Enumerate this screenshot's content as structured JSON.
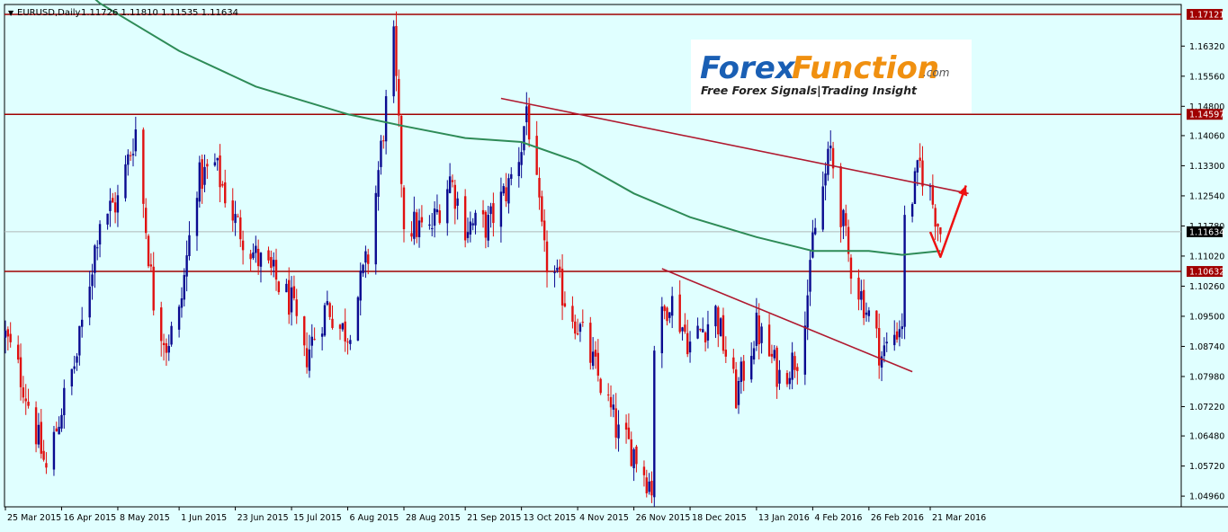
{
  "header": {
    "symbol": "EURUSD,Daily",
    "ohlc": "1.11726 1.11810 1.11535 1.11634",
    "dropdown_glyph": "▼"
  },
  "logo": {
    "brand_part1": "Forex",
    "brand_part2": "Function",
    "suffix": ".com",
    "tagline": "Free Forex Signals|Trading Insight"
  },
  "colors": {
    "background": "#e0ffff",
    "bull": "#0a0a90",
    "bear": "#e01010",
    "ma": "#2e8b57",
    "level": "#a00000",
    "trend": "#b01a30",
    "arrow": "#ee1111"
  },
  "chart_data": {
    "type": "candlestick",
    "symbol": "EURUSD",
    "timeframe": "Daily",
    "y_ticks": [
      "1.16320",
      "1.15560",
      "1.14800",
      "1.14060",
      "1.13300",
      "1.12540",
      "1.11780",
      "1.11020",
      "1.10260",
      "1.09500",
      "1.08740",
      "1.07980",
      "1.07220",
      "1.06480",
      "1.05720",
      "1.04960"
    ],
    "ylim": [
      1.0469,
      1.1737
    ],
    "x_ticks": [
      "25 Mar 2015",
      "16 Apr 2015",
      "8 May 2015",
      "1 Jun 2015",
      "23 Jun 2015",
      "15 Jul 2015",
      "6 Aug 2015",
      "28 Aug 2015",
      "21 Sep 2015",
      "13 Oct 2015",
      "4 Nov 2015",
      "26 Nov 2015",
      "18 Dec 2015",
      "13 Jan 2016",
      "4 Feb 2016",
      "26 Feb 2016",
      "21 Mar 2016"
    ],
    "horizontal_levels": [
      {
        "label": "1.17121",
        "value": 1.17121
      },
      {
        "label": "1.14597",
        "value": 1.14597
      },
      {
        "label": "1.10632",
        "value": 1.10632
      }
    ],
    "current_price": {
      "label": "1.11634",
      "value": 1.11634
    },
    "price_path": [
      [
        "25 Mar 2015",
        1.09
      ],
      [
        "1 Apr 2015",
        1.078
      ],
      [
        "10 Apr 2015",
        1.056
      ],
      [
        "16 Apr 2015",
        1.072
      ],
      [
        "22 Apr 2015",
        1.085
      ],
      [
        "1 May 2015",
        1.12
      ],
      [
        "8 May 2015",
        1.124
      ],
      [
        "15 May 2015",
        1.142
      ],
      [
        "22 May 2015",
        1.099
      ],
      [
        "27 May 2015",
        1.088
      ],
      [
        "1 Jun 2015",
        1.095
      ],
      [
        "8 Jun 2015",
        1.129
      ],
      [
        "15 Jun 2015",
        1.133
      ],
      [
        "23 Jun 2015",
        1.119
      ],
      [
        "1 Jul 2015",
        1.11
      ],
      [
        "8 Jul 2015",
        1.105
      ],
      [
        "15 Jul 2015",
        1.098
      ],
      [
        "20 Jul 2015",
        1.084
      ],
      [
        "29 Jul 2015",
        1.098
      ],
      [
        "3 Aug 2015",
        1.092
      ],
      [
        "6 Aug 2015",
        1.091
      ],
      [
        "14 Aug 2015",
        1.11
      ],
      [
        "24 Aug 2015",
        1.164
      ],
      [
        "28 Aug 2015",
        1.119
      ],
      [
        "7 Sep 2015",
        1.116
      ],
      [
        "15 Sep 2015",
        1.13
      ],
      [
        "21 Sep 2015",
        1.118
      ],
      [
        "30 Sep 2015",
        1.118
      ],
      [
        "8 Oct 2015",
        1.128
      ],
      [
        "13 Oct 2015",
        1.138
      ],
      [
        "15 Oct 2015",
        1.148
      ],
      [
        "22 Oct 2015",
        1.11
      ],
      [
        "26 Oct 2015",
        1.105
      ],
      [
        "4 Nov 2015",
        1.093
      ],
      [
        "13 Nov 2015",
        1.078
      ],
      [
        "20 Nov 2015",
        1.065
      ],
      [
        "26 Nov 2015",
        1.061
      ],
      [
        "3 Dec 2015",
        1.052
      ],
      [
        "4 Dec 2015",
        1.088
      ],
      [
        "10 Dec 2015",
        1.1
      ],
      [
        "18 Dec 2015",
        1.088
      ],
      [
        "28 Dec 2015",
        1.096
      ],
      [
        "5 Jan 2016",
        1.075
      ],
      [
        "13 Jan 2016",
        1.092
      ],
      [
        "22 Jan 2016",
        1.08
      ],
      [
        "29 Jan 2016",
        1.085
      ],
      [
        "3 Feb 2016",
        1.105
      ],
      [
        "4 Feb 2016",
        1.114
      ],
      [
        "11 Feb 2016",
        1.137
      ],
      [
        "18 Feb 2016",
        1.11
      ],
      [
        "22 Feb 2016",
        1.102
      ],
      [
        "26 Feb 2016",
        1.095
      ],
      [
        "2 Mar 2016",
        1.085
      ],
      [
        "10 Mar 2016",
        1.094
      ],
      [
        "11 Mar 2016",
        1.118
      ],
      [
        "17 Mar 2016",
        1.133
      ],
      [
        "21 Mar 2016",
        1.126
      ],
      [
        "25 Mar 2016",
        1.1163
      ]
    ],
    "series": [
      {
        "name": "",
        "type": "line",
        "values": [
          [
            "6 Apr 2015",
            1.188
          ],
          [
            "1 May 2015",
            1.174
          ],
          [
            "1 Jun 2015",
            1.162
          ],
          [
            "1 Jul 2015",
            1.153
          ],
          [
            "6 Aug 2015",
            1.146
          ],
          [
            "28 Aug 2015",
            1.143
          ],
          [
            "21 Sep 2015",
            1.14
          ],
          [
            "13 Oct 2015",
            1.139
          ],
          [
            "4 Nov 2015",
            1.134
          ],
          [
            "26 Nov 2015",
            1.126
          ],
          [
            "18 Dec 2015",
            1.12
          ],
          [
            "13 Jan 2016",
            1.115
          ],
          [
            "4 Feb 2016",
            1.1115
          ],
          [
            "26 Feb 2016",
            1.1115
          ],
          [
            "10 Mar 2016",
            1.1105
          ],
          [
            "25 Mar 2016",
            1.1115
          ]
        ]
      }
    ],
    "trendlines": [
      {
        "points": [
          [
            "5 Oct 2015",
            1.15
          ],
          [
            "5 Apr 2016",
            1.126
          ]
        ]
      },
      {
        "points": [
          [
            "7 Dec 2015",
            1.107
          ],
          [
            "14 Mar 2016",
            1.081
          ]
        ]
      }
    ],
    "forecast_arrow": {
      "points": [
        [
          "21 Mar 2016",
          1.1163
        ],
        [
          "25 Mar 2016",
          1.11
        ],
        [
          "4 Apr 2016",
          1.128
        ]
      ]
    }
  }
}
